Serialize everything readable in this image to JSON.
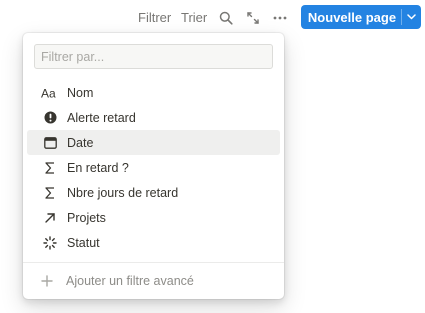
{
  "toolbar": {
    "filter_label": "Filtrer",
    "sort_label": "Trier",
    "search_icon": "search-icon",
    "expand_icon": "expand-icon",
    "more_icon": "more-icon",
    "new_page_label": "Nouvelle page"
  },
  "filter_menu": {
    "search_placeholder": "Filtrer par...",
    "properties": [
      {
        "label": "Nom",
        "icon": "text-aa-icon"
      },
      {
        "label": "Alerte retard",
        "icon": "alert-icon"
      },
      {
        "label": "Date",
        "icon": "calendar-icon"
      },
      {
        "label": "En retard ?",
        "icon": "sigma-icon"
      },
      {
        "label": "Nbre jours de retard",
        "icon": "sigma-icon"
      },
      {
        "label": "Projets",
        "icon": "relation-arrow-icon"
      },
      {
        "label": "Statut",
        "icon": "status-spinner-icon"
      }
    ],
    "highlighted_index": 2,
    "advanced_label": "Ajouter un filtre avancé"
  },
  "colors": {
    "accent": "#2383e2",
    "hover_bg": "#efefee",
    "text": "#37352f",
    "muted": "#787774"
  }
}
